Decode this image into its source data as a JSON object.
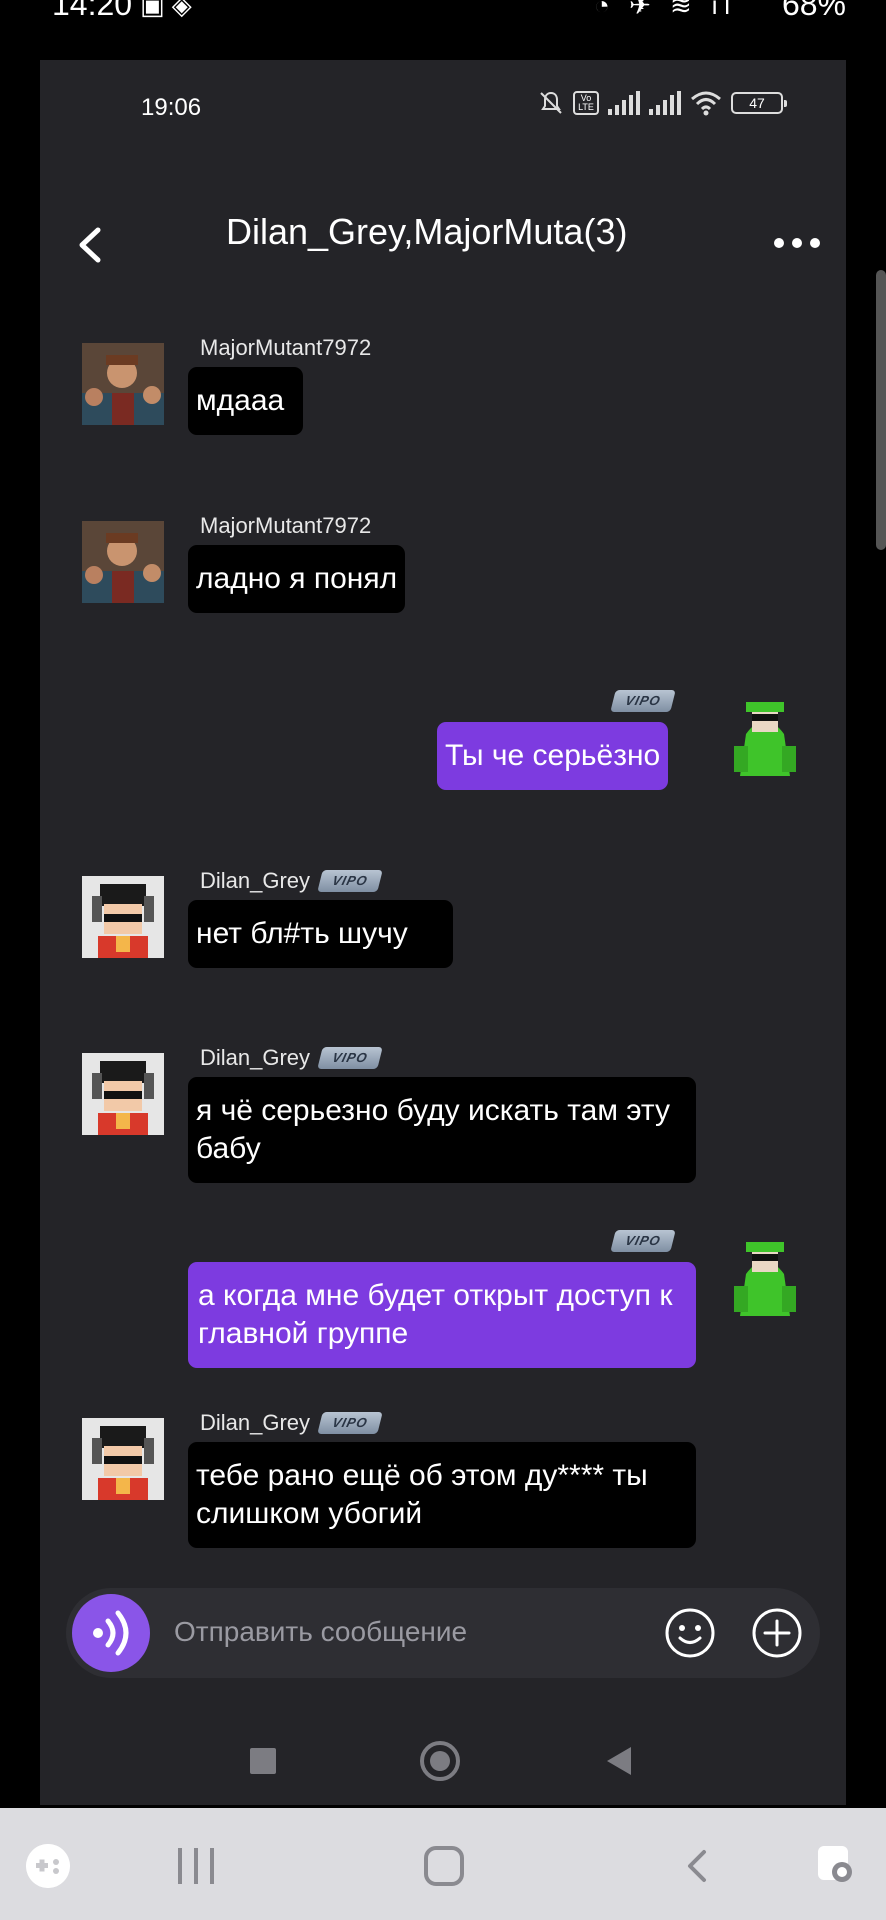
{
  "outer_status": {
    "time": "14:20",
    "battery": "68%"
  },
  "inner_status": {
    "time": "19:06",
    "battery": "47",
    "volte": "Vo LTE"
  },
  "header": {
    "title": "Dilan_Grey,MajorMuta(3)"
  },
  "vip_badge": "VIPO",
  "messages": [
    {
      "direction": "in",
      "sender": "MajorMutant7972",
      "text": "мдааа",
      "vip": false
    },
    {
      "direction": "in",
      "sender": "MajorMutant7972",
      "text": "ладно я понял",
      "vip": false
    },
    {
      "direction": "out",
      "text": "Ты че серьёзно",
      "vip": true
    },
    {
      "direction": "in",
      "sender": "Dilan_Grey",
      "text": "нет бл#ть шучу",
      "vip": true
    },
    {
      "direction": "in",
      "sender": "Dilan_Grey",
      "text": "я чё серьезно буду искать там эту бабу",
      "vip": true
    },
    {
      "direction": "out",
      "text": "а когда мне будет открыт доступ к главной группе",
      "vip": true
    },
    {
      "direction": "in",
      "sender": "Dilan_Grey",
      "text": "тебе рано ещё об этом ду**** ты слишком убогий",
      "vip": true
    }
  ],
  "input": {
    "placeholder": "Отправить сообщение"
  },
  "colors": {
    "background": "#242428",
    "outgoing_bubble": "#7d3be0",
    "incoming_bubble": "#000000",
    "voice_button": "#8a55e8"
  },
  "icons": [
    "back-chevron-icon",
    "more-dots-icon",
    "voice-icon",
    "emoji-icon",
    "plus-icon"
  ]
}
